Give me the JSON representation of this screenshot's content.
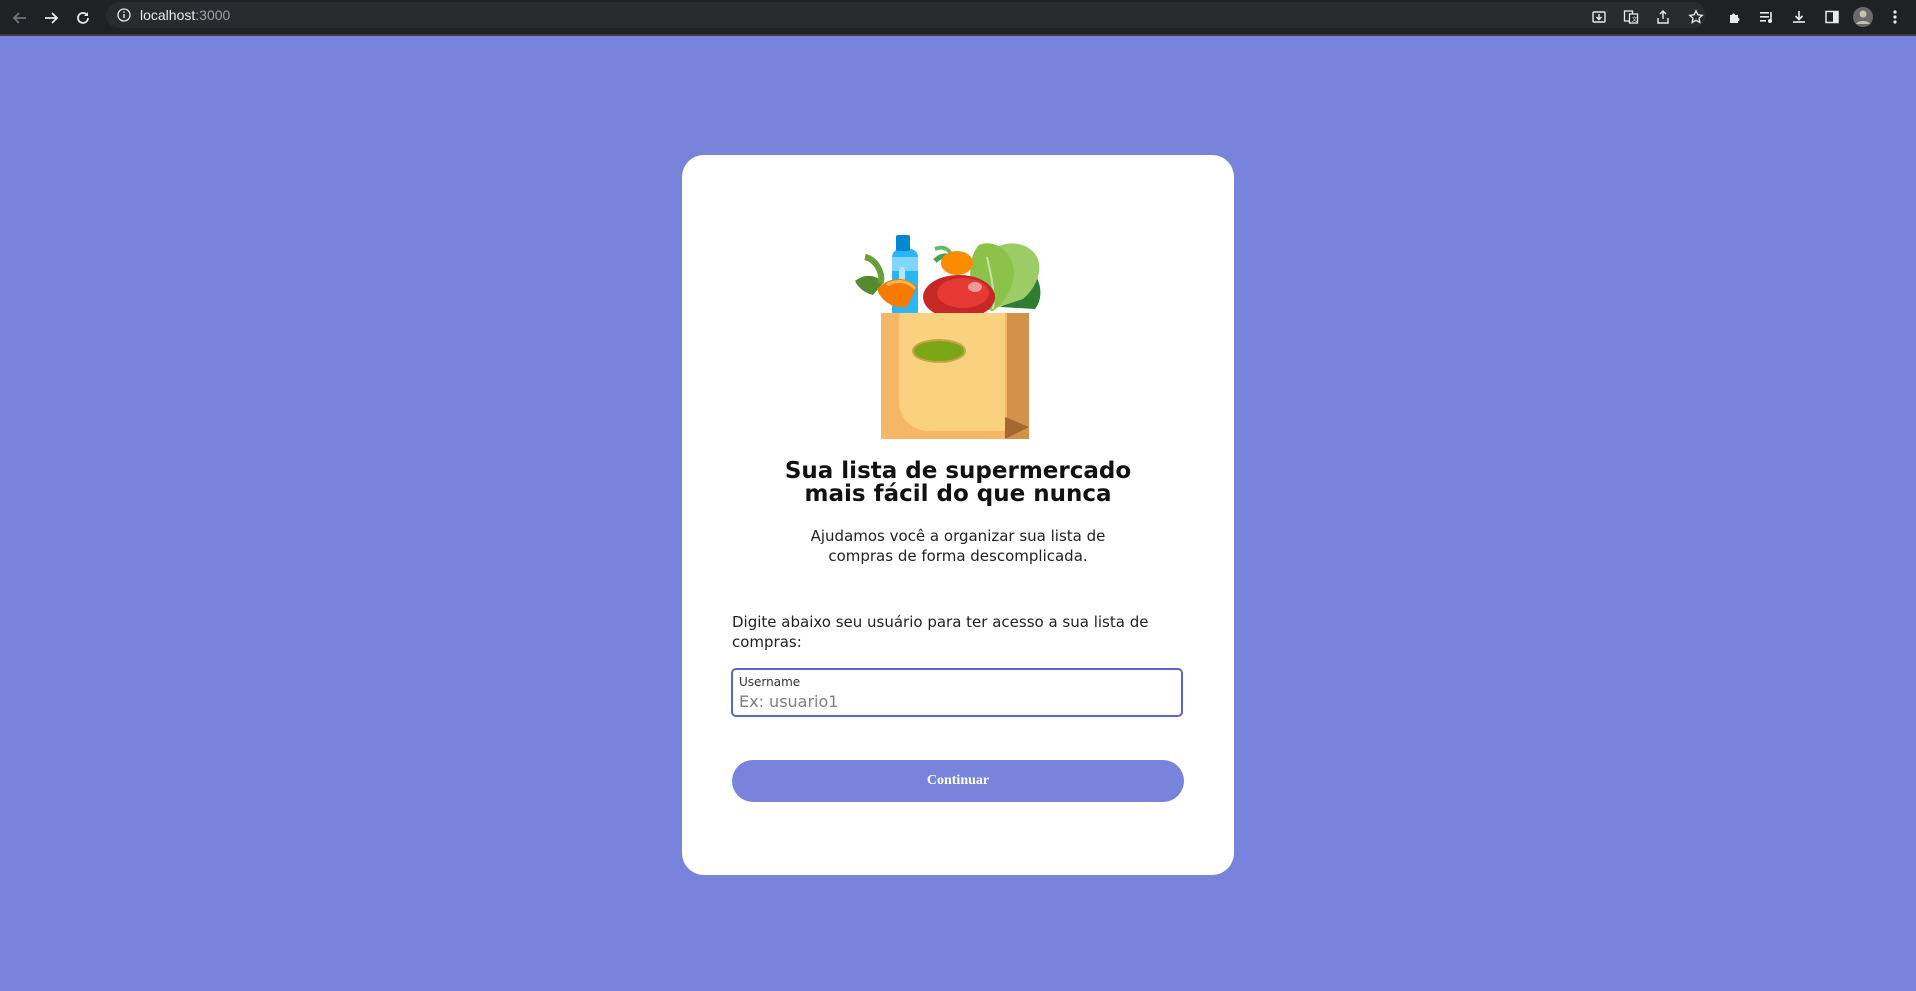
{
  "browser": {
    "url_host": "localhost",
    "url_port": ":3000",
    "icons": [
      "back-icon",
      "forward-icon",
      "reload-icon",
      "info-icon",
      "install-icon",
      "translate-icon",
      "share-icon",
      "bookmark-star-icon",
      "extensions-icon",
      "media-icon",
      "download-icon",
      "side-panel-icon",
      "profile-avatar",
      "menu-icon"
    ]
  },
  "card": {
    "headline_line1": "Sua lista de supermercado",
    "headline_line2": "mais fácil do que nunca",
    "subtext_line1": "Ajudamos você a organizar sua lista de",
    "subtext_line2": "compras de forma descomplicada.",
    "prompt_line1": "Digite abaixo seu usuário para ter acesso a sua lista de",
    "prompt_line2": "compras:",
    "field_label": "Username",
    "field_placeholder": "Ex: usuario1",
    "field_value": "",
    "button_label": "Continuar"
  },
  "colors": {
    "page_background": "#7884dc",
    "card_background": "#ffffff",
    "accent": "#7884dc",
    "input_border": "#5b64cc"
  }
}
